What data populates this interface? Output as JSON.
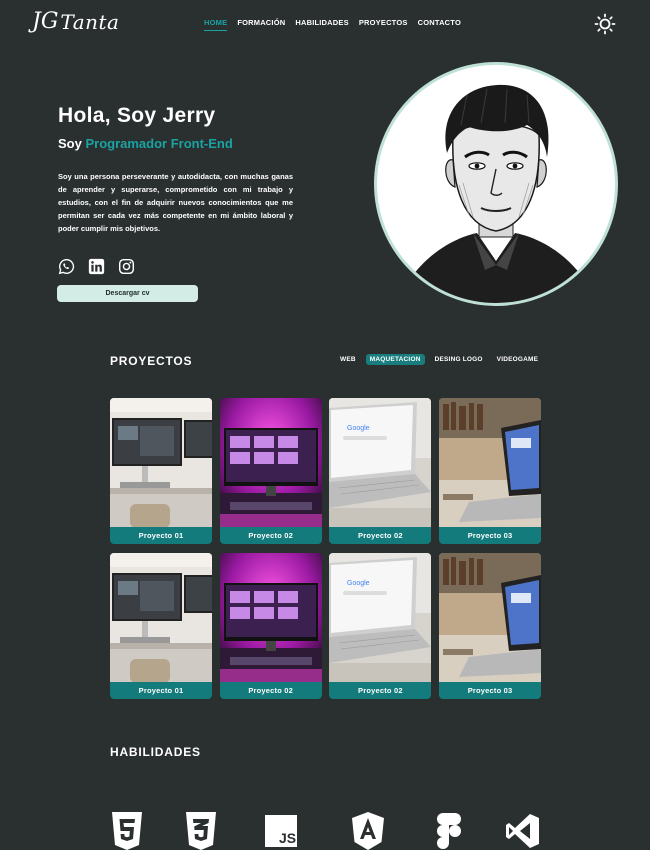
{
  "header": {
    "logo_mark": "JG",
    "logo_text": "Tanta",
    "nav": [
      {
        "label": "HOME",
        "active": true
      },
      {
        "label": "FORMACIÓN",
        "active": false
      },
      {
        "label": "HABILIDADES",
        "active": false
      },
      {
        "label": "PROYECTOS",
        "active": false
      },
      {
        "label": "CONTACTO",
        "active": false
      }
    ],
    "theme_icon": "sun-icon"
  },
  "hero": {
    "greeting": "Hola, Soy Jerry",
    "sub_prefix": "Soy ",
    "role": "Programador Front-End",
    "description": "Soy una persona perseverante y autodidacta, con muchas ganas de aprender y superarse, comprometido con mi trabajo y estudios, con el fin de adquirir nuevos conocimientos que me permitan ser cada vez más competente en mi ámbito laboral y poder cumplir mis objetivos.",
    "socials": [
      "whatsapp-icon",
      "linkedin-icon",
      "instagram-icon"
    ],
    "cv_button": "Descargar cv"
  },
  "projects": {
    "title": "PROYECTOS",
    "filters": [
      {
        "label": "WEB",
        "active": false
      },
      {
        "label": "MAQUETACION",
        "active": true
      },
      {
        "label": "DESING LOGO",
        "active": false
      },
      {
        "label": "VIDEOGAME",
        "active": false
      }
    ],
    "cards": [
      {
        "label": "Proyecto 01",
        "thumb": "desk"
      },
      {
        "label": "Proyecto 02",
        "thumb": "neon"
      },
      {
        "label": "Proyecto 02",
        "thumb": "google"
      },
      {
        "label": "Proyecto 03",
        "thumb": "laptop"
      },
      {
        "label": "Proyecto 01",
        "thumb": "desk"
      },
      {
        "label": "Proyecto 02",
        "thumb": "neon"
      },
      {
        "label": "Proyecto 02",
        "thumb": "google"
      },
      {
        "label": "Proyecto 03",
        "thumb": "laptop"
      }
    ]
  },
  "skills": {
    "title": "HABILIDADES",
    "icons": [
      "html5-icon",
      "css3-icon",
      "javascript-icon",
      "angular-icon",
      "figma-icon",
      "vscode-icon"
    ],
    "js_text": "JS"
  },
  "colors": {
    "background": "#2a2f2f",
    "accent": "#1aa3a3",
    "card_label": "#137b7b",
    "button": "#d3ede6"
  }
}
